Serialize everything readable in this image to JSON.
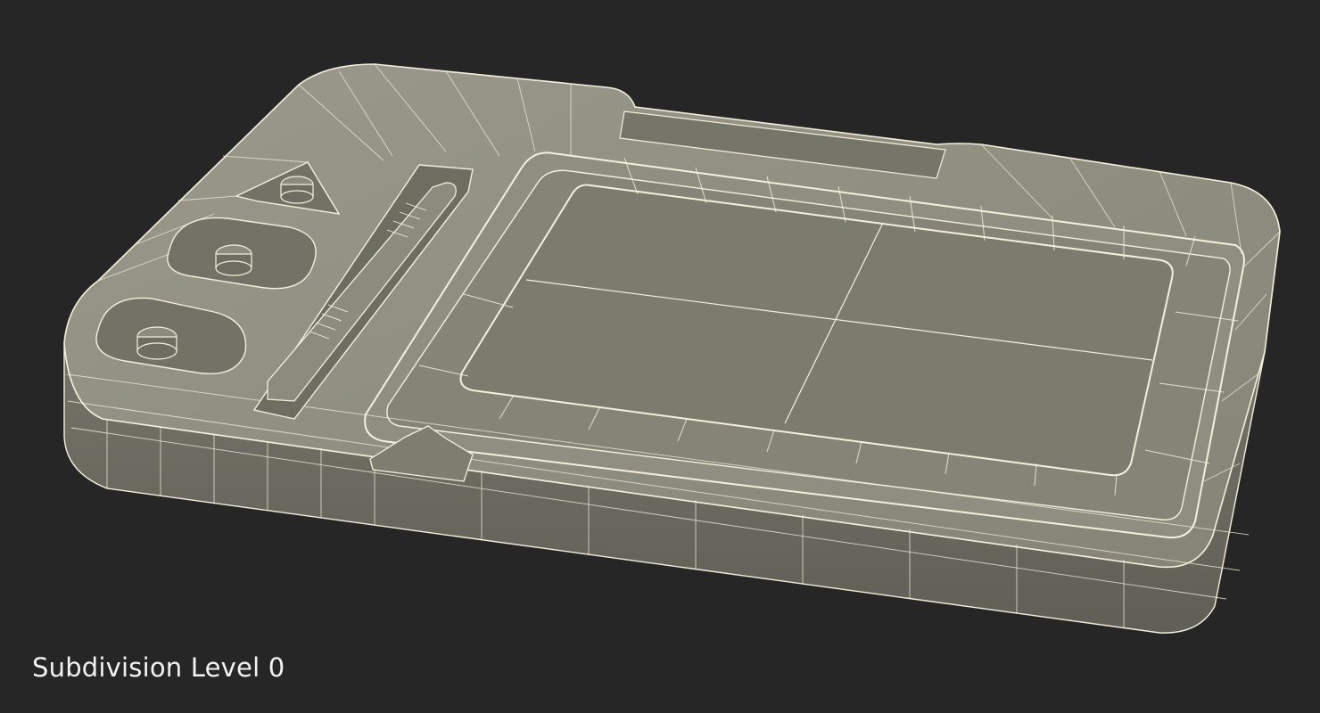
{
  "viewport": {
    "background_color": "#262626",
    "caption": "Subdivision Level 0"
  },
  "model": {
    "object": "drawing-tablet-wireframe",
    "shell_color": "#8c8b7d",
    "shell_dark_color": "#6e6d62",
    "screen_color": "#7b7b6e",
    "wire_color": "#f4f0dc"
  }
}
